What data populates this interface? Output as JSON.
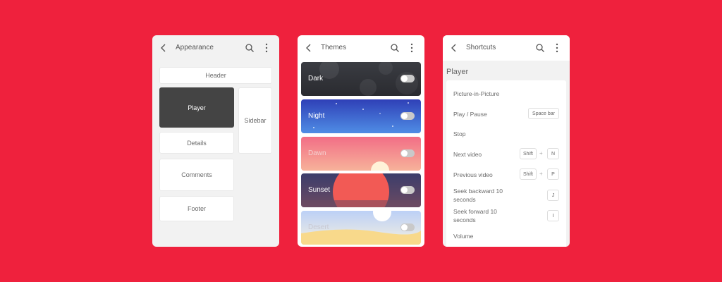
{
  "panels": {
    "appearance": {
      "title": "Appearance",
      "layout": {
        "header": "Header",
        "player": "Player",
        "sidebar": "Sidebar",
        "details": "Details",
        "comments": "Comments",
        "footer": "Footer"
      }
    },
    "themes": {
      "title": "Themes",
      "items": [
        {
          "name": "Dark",
          "enabled": false
        },
        {
          "name": "Night",
          "enabled": false
        },
        {
          "name": "Dawn",
          "enabled": false
        },
        {
          "name": "Sunset",
          "enabled": false
        },
        {
          "name": "Desert",
          "enabled": false
        }
      ]
    },
    "shortcuts": {
      "title": "Shortcuts",
      "section": "Player",
      "items": [
        {
          "label": "Picture-in-Picture",
          "keys": []
        },
        {
          "label": "Play / Pause",
          "keys": [
            "Space bar"
          ]
        },
        {
          "label": "Stop",
          "keys": []
        },
        {
          "label": "Next video",
          "keys": [
            "Shift",
            "N"
          ]
        },
        {
          "label": "Previous video",
          "keys": [
            "Shift",
            "P"
          ]
        },
        {
          "label": "Seek backward 10 seconds",
          "keys": [
            "J"
          ]
        },
        {
          "label": "Seek forward 10 seconds",
          "keys": [
            "I"
          ]
        },
        {
          "label": "Volume",
          "keys": []
        }
      ]
    }
  },
  "colors": {
    "background": "#ef213d",
    "panel": "#f2f2f2",
    "accent_dark": "#444444"
  },
  "icons": [
    "back-arrow-icon",
    "search-icon",
    "more-vertical-icon"
  ]
}
